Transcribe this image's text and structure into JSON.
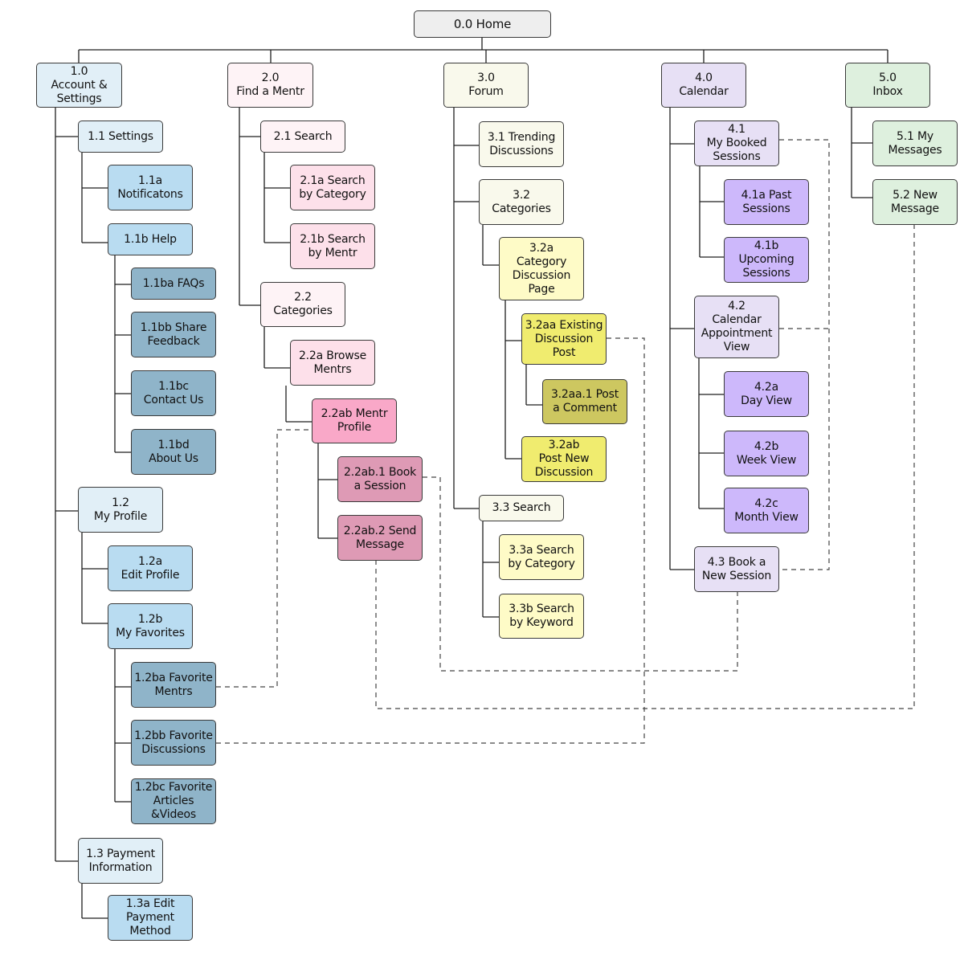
{
  "diagram": {
    "type": "sitemap",
    "title": "0.0 Home",
    "nodes": {
      "n0_0": "0.0 Home",
      "n1_0": "1.0\nAccount &\nSettings",
      "n1_1": "1.1 Settings",
      "n1_1a": "1.1a\nNotificatons",
      "n1_1b": "1.1b Help",
      "n1_1ba": "1.1ba FAQs",
      "n1_1bb": "1.1bb Share\nFeedback",
      "n1_1bc": "1.1bc\nContact Us",
      "n1_1bd": "1.1bd\nAbout Us",
      "n1_2": "1.2\nMy Profile",
      "n1_2a": "1.2a\nEdit Profile",
      "n1_2b": "1.2b\nMy Favorites",
      "n1_2ba": "1.2ba Favorite\nMentrs",
      "n1_2bb": "1.2bb Favorite\nDiscussions",
      "n1_2bc": "1.2bc Favorite\nArticles\n&Videos",
      "n1_3": "1.3 Payment\nInformation",
      "n1_3a": "1.3a Edit\nPayment\nMethod",
      "n2_0": "2.0\nFind a Mentr",
      "n2_1": "2.1 Search",
      "n2_1a": "2.1a Search\nby Category",
      "n2_1b": "2.1b Search\nby Mentr",
      "n2_2": "2.2\nCategories",
      "n2_2a": "2.2a Browse\nMentrs",
      "n2_2ab": "2.2ab Mentr\nProfile",
      "n2_2ab1": "2.2ab.1 Book\na Session",
      "n2_2ab2": "2.2ab.2 Send\nMessage",
      "n3_0": "3.0\nForum",
      "n3_1": "3.1 Trending\nDiscussions",
      "n3_2": "3.2\nCategories",
      "n3_2a": "3.2a\nCategory\nDiscussion\nPage",
      "n3_2aa": "3.2aa Existing\nDiscussion\nPost",
      "n3_2aa1": "3.2aa.1 Post\na Comment",
      "n3_2ab": "3.2ab\nPost New\nDiscussion",
      "n3_3": "3.3 Search",
      "n3_3a": "3.3a Search\nby Category",
      "n3_3b": "3.3b Search\nby Keyword",
      "n4_0": "4.0\nCalendar",
      "n4_1": "4.1\nMy Booked\nSessions",
      "n4_1a": "4.1a Past\nSessions",
      "n4_1b": "4.1b\nUpcoming\nSessions",
      "n4_2": "4.2\nCalendar\nAppointment\nView",
      "n4_2a": "4.2a\nDay View",
      "n4_2b": "4.2b\nWeek View",
      "n4_2c": "4.2c\nMonth View",
      "n4_3": "4.3 Book a\nNew Session",
      "n5_0": "5.0\nInbox",
      "n5_1": "5.1 My\nMessages",
      "n5_2": "5.2 New\nMessage"
    },
    "cross_links": [
      {
        "from": "1.2ba Favorite Mentrs",
        "to": "2.2ab Mentr Profile"
      },
      {
        "from": "1.2bb Favorite Discussions",
        "to": "3.2aa Existing Discussion Post"
      },
      {
        "from": "2.2ab.1 Book a Session",
        "to": "4.3 Book a New Session"
      },
      {
        "from": "2.2ab.2 Send Message",
        "to": "5.2 New Message"
      },
      {
        "from": "4.1 My Booked Sessions",
        "to": "4.3 Book a New Session"
      },
      {
        "from": "4.2 Calendar Appointment View",
        "to": "4.3 Book a New Session"
      }
    ],
    "colors": {
      "home": "#eeeeee",
      "account_light": "#e1eff7",
      "account_mid": "#b9dcf1",
      "account_dark": "#8fb4c9",
      "mentr_light": "#fef3f6",
      "mentr_mid": "#fde0ea",
      "mentr_strong": "#f9a8c8",
      "mentr_dark": "#de9ab5",
      "forum_light": "#f9f9ec",
      "forum_mid": "#fefbc7",
      "forum_strong": "#f0ec6f",
      "forum_dark": "#cdc760",
      "calendar_light": "#e7e0f5",
      "calendar_mid": "#cdb8fb",
      "inbox_light": "#def0de"
    }
  }
}
